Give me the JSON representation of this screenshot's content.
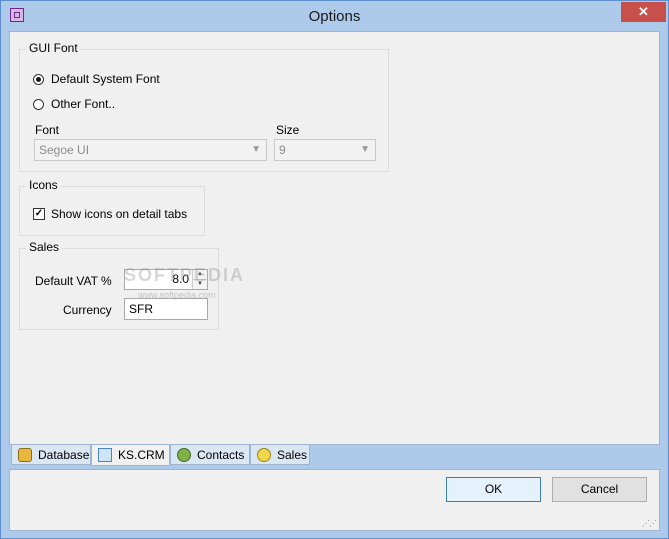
{
  "window": {
    "title": "Options",
    "close_label": "✕"
  },
  "gui_font": {
    "legend": "GUI Font",
    "option_default": "Default System Font",
    "option_other": "Other Font..",
    "selected": "Default System Font",
    "font_label": "Font",
    "font_value": "Segoe UI",
    "size_label": "Size",
    "size_value": "9"
  },
  "icons": {
    "legend": "Icons",
    "show_icons_label": "Show icons on detail tabs",
    "show_icons_checked": true
  },
  "sales": {
    "legend": "Sales",
    "vat_label": "Default VAT %",
    "vat_value": "8.0",
    "currency_label": "Currency",
    "currency_value": "SFR"
  },
  "watermark": {
    "text": "SOFTPEDIA",
    "sub": "www.softpedia.com"
  },
  "tabs": [
    {
      "label": "Database",
      "icon": "database-icon"
    },
    {
      "label": "KS.CRM",
      "icon": "crm-window-icon",
      "active": true
    },
    {
      "label": "Contacts",
      "icon": "contacts-icon"
    },
    {
      "label": "Sales",
      "icon": "sales-icon"
    }
  ],
  "buttons": {
    "ok": "OK",
    "cancel": "Cancel"
  },
  "colors": {
    "accent": "#3c7fb1",
    "frame": "#aecaea",
    "close": "#c7504a"
  }
}
